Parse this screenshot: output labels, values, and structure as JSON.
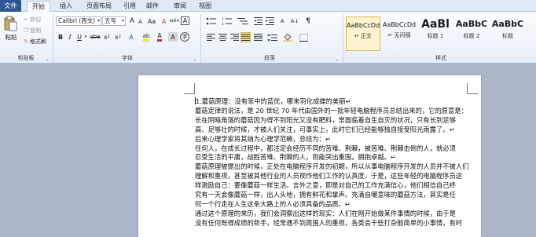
{
  "tabs": [
    "文件",
    "开始",
    "插入",
    "页面布局",
    "引用",
    "邮件",
    "审阅",
    "视图"
  ],
  "clipboard": {
    "paste": "粘贴",
    "cut": "剪切",
    "copy": "复制",
    "format_painter": "格式刷",
    "group": "剪贴板"
  },
  "font": {
    "family": "Calibri (西文)",
    "size": "五号",
    "group": "字体",
    "grow": "A",
    "shrink": "A",
    "case": "Aa",
    "clear": "A",
    "wen": "wén",
    "char_box": "A",
    "bold": "B",
    "italic": "I",
    "underline": "U",
    "strike": "abe",
    "subscript": "x",
    "superscript": "x",
    "highlight": "ab",
    "color": "A",
    "shade": "A",
    "circle": "字"
  },
  "paragraph": {
    "group": "段落",
    "sort_label": "A↓",
    "asian_label": "A"
  },
  "styles": {
    "group": "样式",
    "items": [
      {
        "sample": "AaBbCcDd",
        "name": "↵ 正文"
      },
      {
        "sample": "AaBbCcDd",
        "name": "↵ 无间隔"
      },
      {
        "sample": "AaBl",
        "name": "标题 1"
      },
      {
        "sample": "AaBbC",
        "name": "标题 2"
      },
      {
        "sample": "AaBbC",
        "name": "标题"
      }
    ]
  },
  "document": {
    "lines": [
      "1.蘑菇原理：没有笨中的蓝优，哪来羽化成蝶的美丽↵",
      "蘑菇定律的说法，是 20 世纪 70 年代由国外的一批年轻电脑程序员总结出来的，它的原意是：",
      "长在阴暗角落的蘑菇因为得不到阳光又没有肥料，常面临着自生自灭的状况，只有长到足够",
      "高、足够壮的时候，才被人们关注，可事实上，此时它们已经能够独自接受阳光雨露了。↵",
      "后来心理学家将其纳为心理学范畴，总结为：↵",
      "任何人，在成长过程中，都注定会经历不同的苦难、荆棘，被苦难、荆棘击倒的人，就必须",
      "忍受生活的平庸，战胜苦难、荆棘的人，则能突出重围，拥抱卓越。↵",
      "蘑菇原理被提出的时候，正处在电脑程序开发的初期，所以从事电脑程序开发的人员并不被人们",
      "理解和重视，甚至被其他行业的人员视作他们工作的认真度。于是，这些年轻的电脑程序员这",
      "样激励自己：要像蘑菇一样生活。言外之意，即是对自己的工作充满信心，他们相信自己终",
      "究有一天会像蘑菇一样，出人头地，拥有鲜花和掌声。充满自嘲意味的蘑菇方法，其实是任",
      "何一个行走在人生这条大路上的人必须具备的品质。↵",
      "通过这个原理的来历，我们会洞察出这样的现实：人们在刚开始做某件事情的时候，由于是",
      "没有任何既得成绩的新手，经常遇不到周围人的重视，各类会干些打杂般简单的小事情，有时"
    ]
  }
}
